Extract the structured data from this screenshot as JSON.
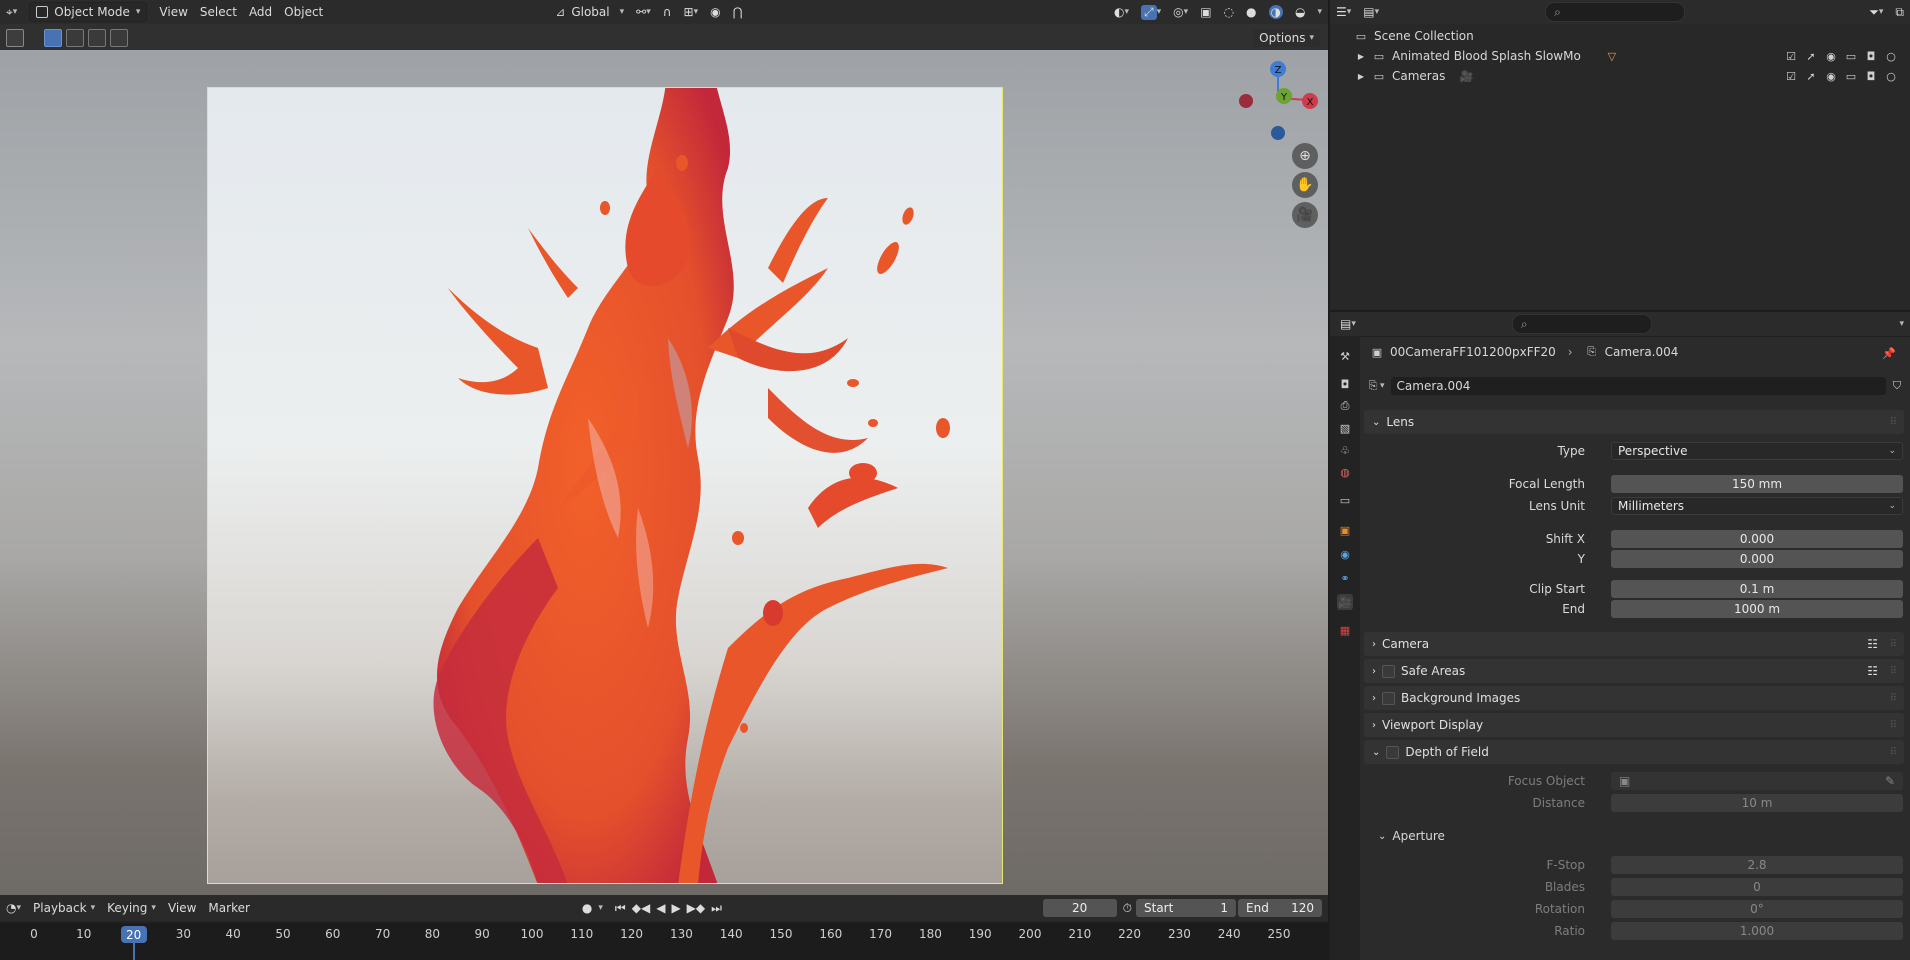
{
  "viewport": {
    "header": {
      "mode": "Object Mode",
      "menus": [
        "View",
        "Select",
        "Add",
        "Object"
      ],
      "transform_orientation": "Global"
    },
    "options_label": "Options",
    "gizmo": {
      "z": "Z",
      "y": "Y",
      "x": "X"
    }
  },
  "timeline": {
    "menus": [
      "Playback",
      "Keying",
      "View",
      "Marker"
    ],
    "current_frame": "20",
    "start_label": "Start",
    "start_value": "1",
    "end_label": "End",
    "end_value": "120",
    "ticks": [
      "0",
      "10",
      "20",
      "30",
      "40",
      "50",
      "60",
      "70",
      "80",
      "90",
      "100",
      "110",
      "120",
      "130",
      "140",
      "150",
      "160",
      "170",
      "180",
      "190",
      "200",
      "210",
      "220",
      "230",
      "240",
      "250"
    ],
    "ruler_current": "20"
  },
  "outliner": {
    "root": "Scene Collection",
    "items": [
      {
        "label": "Animated Blood Splash SlowMo"
      },
      {
        "label": "Cameras"
      }
    ]
  },
  "properties": {
    "breadcrumb_object": "00CameraFF101200pxFF20",
    "breadcrumb_data": "Camera.004",
    "datablock_name": "Camera.004",
    "lens": {
      "title": "Lens",
      "type_label": "Type",
      "type_value": "Perspective",
      "focal_label": "Focal Length",
      "focal_value": "150 mm",
      "unit_label": "Lens Unit",
      "unit_value": "Millimeters",
      "shiftx_label": "Shift X",
      "shiftx_value": "0.000",
      "shifty_label": "Y",
      "shifty_value": "0.000",
      "clipstart_label": "Clip Start",
      "clipstart_value": "0.1 m",
      "clipend_label": "End",
      "clipend_value": "1000 m"
    },
    "panels": {
      "camera": "Camera",
      "safe_areas": "Safe Areas",
      "background_images": "Background Images",
      "viewport_display": "Viewport Display",
      "dof": "Depth of Field"
    },
    "dof": {
      "focus_label": "Focus Object",
      "distance_label": "Distance",
      "distance_value": "10 m",
      "aperture_title": "Aperture",
      "fstop_label": "F-Stop",
      "fstop_value": "2.8",
      "blades_label": "Blades",
      "blades_value": "0",
      "rotation_label": "Rotation",
      "rotation_value": "0°",
      "ratio_label": "Ratio",
      "ratio_value": "1.000"
    }
  },
  "colors": {
    "accent": "#4772b3",
    "splash_main": "#e8562a",
    "splash_dark": "#c2283a",
    "frame_border": "#e8e870"
  }
}
